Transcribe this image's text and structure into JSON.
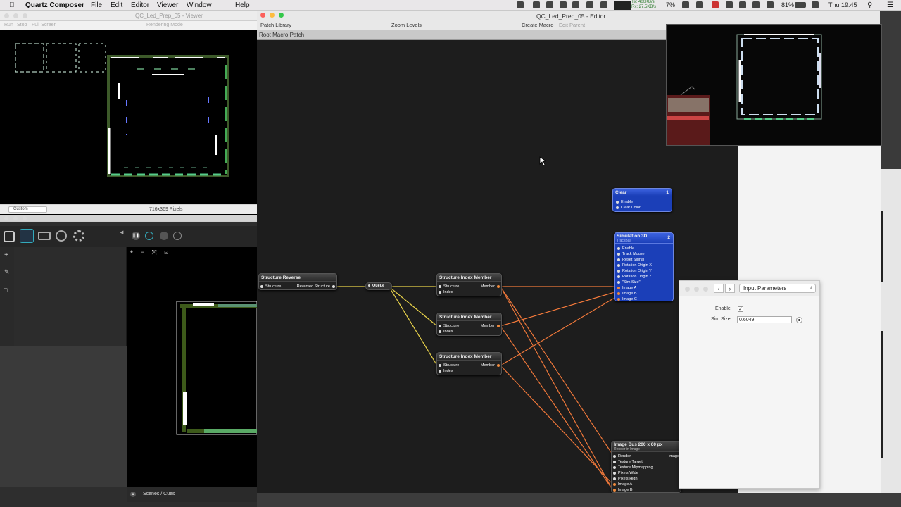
{
  "menubar": {
    "app_name": "Quartz Composer",
    "items": [
      "File",
      "Edit",
      "Editor",
      "Viewer",
      "Window",
      "Help"
    ],
    "net_tx": "Tx:  400KB/s",
    "net_rx": "Rx:  27.5KB/s",
    "cpu_percent": "7%",
    "battery": "81%",
    "clock": "Thu 19:45"
  },
  "viewer": {
    "title": "QC_Led_Prep_05 - Viewer",
    "toolbar": {
      "run": "Run",
      "stop": "Stop",
      "fullscreen": "Full Screen",
      "rendering_mode": "Rendering Mode"
    },
    "size_select": "Custom",
    "pixels_label": "716x369 Pixels"
  },
  "editor": {
    "title": "QC_Led_Prep_05 - Editor",
    "toolbar": {
      "patch_library": "Patch Library",
      "zoom_levels": "Zoom Levels",
      "create_macro": "Create Macro",
      "edit_parent": "Edit Parent"
    },
    "breadcrumb": "Root Macro Patch",
    "patches": {
      "structure_reverse": {
        "title": "Structure Reverse",
        "in": "Structure",
        "out": "Reversed Structure"
      },
      "queue": {
        "title": "Queue"
      },
      "sim1": {
        "title": "Structure Index Member",
        "in1": "Structure",
        "in2": "Index",
        "out": "Member"
      },
      "sim2": {
        "title": "Structure Index Member",
        "in1": "Structure",
        "in2": "Index",
        "out": "Member"
      },
      "sim3": {
        "title": "Structure Index Member",
        "in1": "Structure",
        "in2": "Index",
        "out": "Member"
      },
      "clear": {
        "title": "Clear",
        "badge": "1",
        "ports": [
          "Enable",
          "Clear Color"
        ]
      },
      "sim3d": {
        "title": "Simulation 3D",
        "subtitle": "TrackBall",
        "badge": "2",
        "ports": [
          "Enable",
          "Track Mouse",
          "Reset Signal",
          "Rotation Origin X",
          "Rotation Origin Y",
          "Rotation Origin Z",
          "\"Sim Size\"",
          "Image A",
          "Image B",
          "Image C"
        ]
      },
      "imagebus": {
        "title": "Image Bus 200 x 60 px",
        "subtitle": "Render in Image",
        "out": "Image",
        "ports": [
          "Render",
          "Texture Target",
          "Texture Mipmapping",
          "Pixels Wide",
          "Pixels High",
          "Image A",
          "Image B"
        ]
      }
    }
  },
  "input_parameters": {
    "title": "Input Parameters",
    "enable_label": "Enable",
    "enable_checked": true,
    "sim_size_label": "Sim Size",
    "sim_size_value": "0.6049"
  },
  "light_app": {
    "footer_label": "Scenes / Cues"
  },
  "colors": {
    "connection_yellow": "#e8d24a",
    "connection_orange": "#f0783a",
    "blue_patch": "#1b3fb8"
  }
}
